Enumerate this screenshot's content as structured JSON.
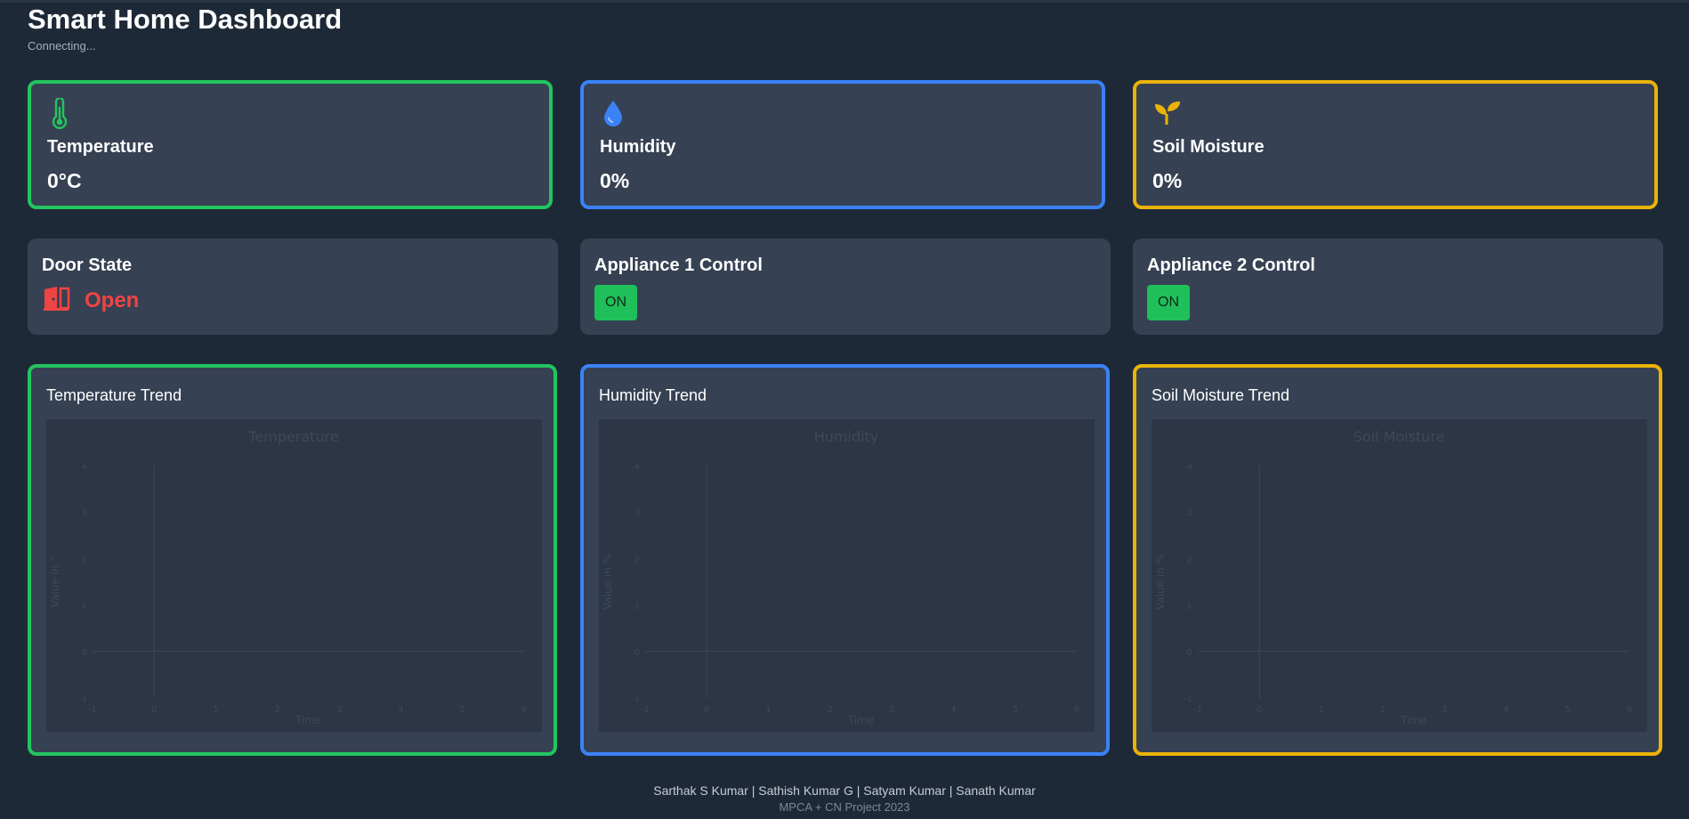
{
  "header": {
    "title": "Smart Home Dashboard",
    "status": "Connecting..."
  },
  "colors": {
    "temperature": "#22c55e",
    "humidity": "#3b82f6",
    "soil": "#eab308",
    "door_open": "#ef4444",
    "on_button": "#1fc05a"
  },
  "sensors": {
    "temperature": {
      "label": "Temperature",
      "value": "0°C",
      "icon": "thermometer-icon"
    },
    "humidity": {
      "label": "Humidity",
      "value": "0%",
      "icon": "water-drop-icon"
    },
    "soil": {
      "label": "Soil Moisture",
      "value": "0%",
      "icon": "seedling-icon"
    }
  },
  "controls": {
    "door": {
      "label": "Door State",
      "state": "Open",
      "icon": "door-open-icon"
    },
    "appliance1": {
      "label": "Appliance 1 Control",
      "button": "ON"
    },
    "appliance2": {
      "label": "Appliance 2 Control",
      "button": "ON"
    }
  },
  "trends": {
    "temperature": {
      "card_title": "Temperature Trend"
    },
    "humidity": {
      "card_title": "Humidity Trend"
    },
    "soil": {
      "card_title": "Soil Moisture Trend"
    }
  },
  "chart_data": [
    {
      "type": "line",
      "title": "Temperature",
      "xlabel": "Time",
      "ylabel": "Value in °",
      "xlim": [
        -1,
        6
      ],
      "ylim": [
        -1,
        4
      ],
      "x_ticks": [
        "-1",
        "0",
        "1",
        "2",
        "3",
        "4",
        "5",
        "6"
      ],
      "y_ticks": [
        "-1",
        "0",
        "1",
        "2",
        "3",
        "4"
      ],
      "series": []
    },
    {
      "type": "line",
      "title": "Humidity",
      "xlabel": "Time",
      "ylabel": "Value in %",
      "xlim": [
        -1,
        6
      ],
      "ylim": [
        -1,
        4
      ],
      "x_ticks": [
        "-1",
        "0",
        "1",
        "2",
        "3",
        "4",
        "5",
        "6"
      ],
      "y_ticks": [
        "-1",
        "0",
        "1",
        "2",
        "3",
        "4"
      ],
      "series": []
    },
    {
      "type": "line",
      "title": "Soil Moisture",
      "xlabel": "Time",
      "ylabel": "Value in %",
      "xlim": [
        -1,
        6
      ],
      "ylim": [
        -1,
        4
      ],
      "x_ticks": [
        "-1",
        "0",
        "1",
        "2",
        "3",
        "4",
        "5",
        "6"
      ],
      "y_ticks": [
        "-1",
        "0",
        "1",
        "2",
        "3",
        "4"
      ],
      "series": []
    }
  ],
  "footer": {
    "credits": "Sarthak S Kumar | Sathish Kumar G | Satyam Kumar | Sanath Kumar",
    "project": "MPCA + CN Project 2023"
  }
}
